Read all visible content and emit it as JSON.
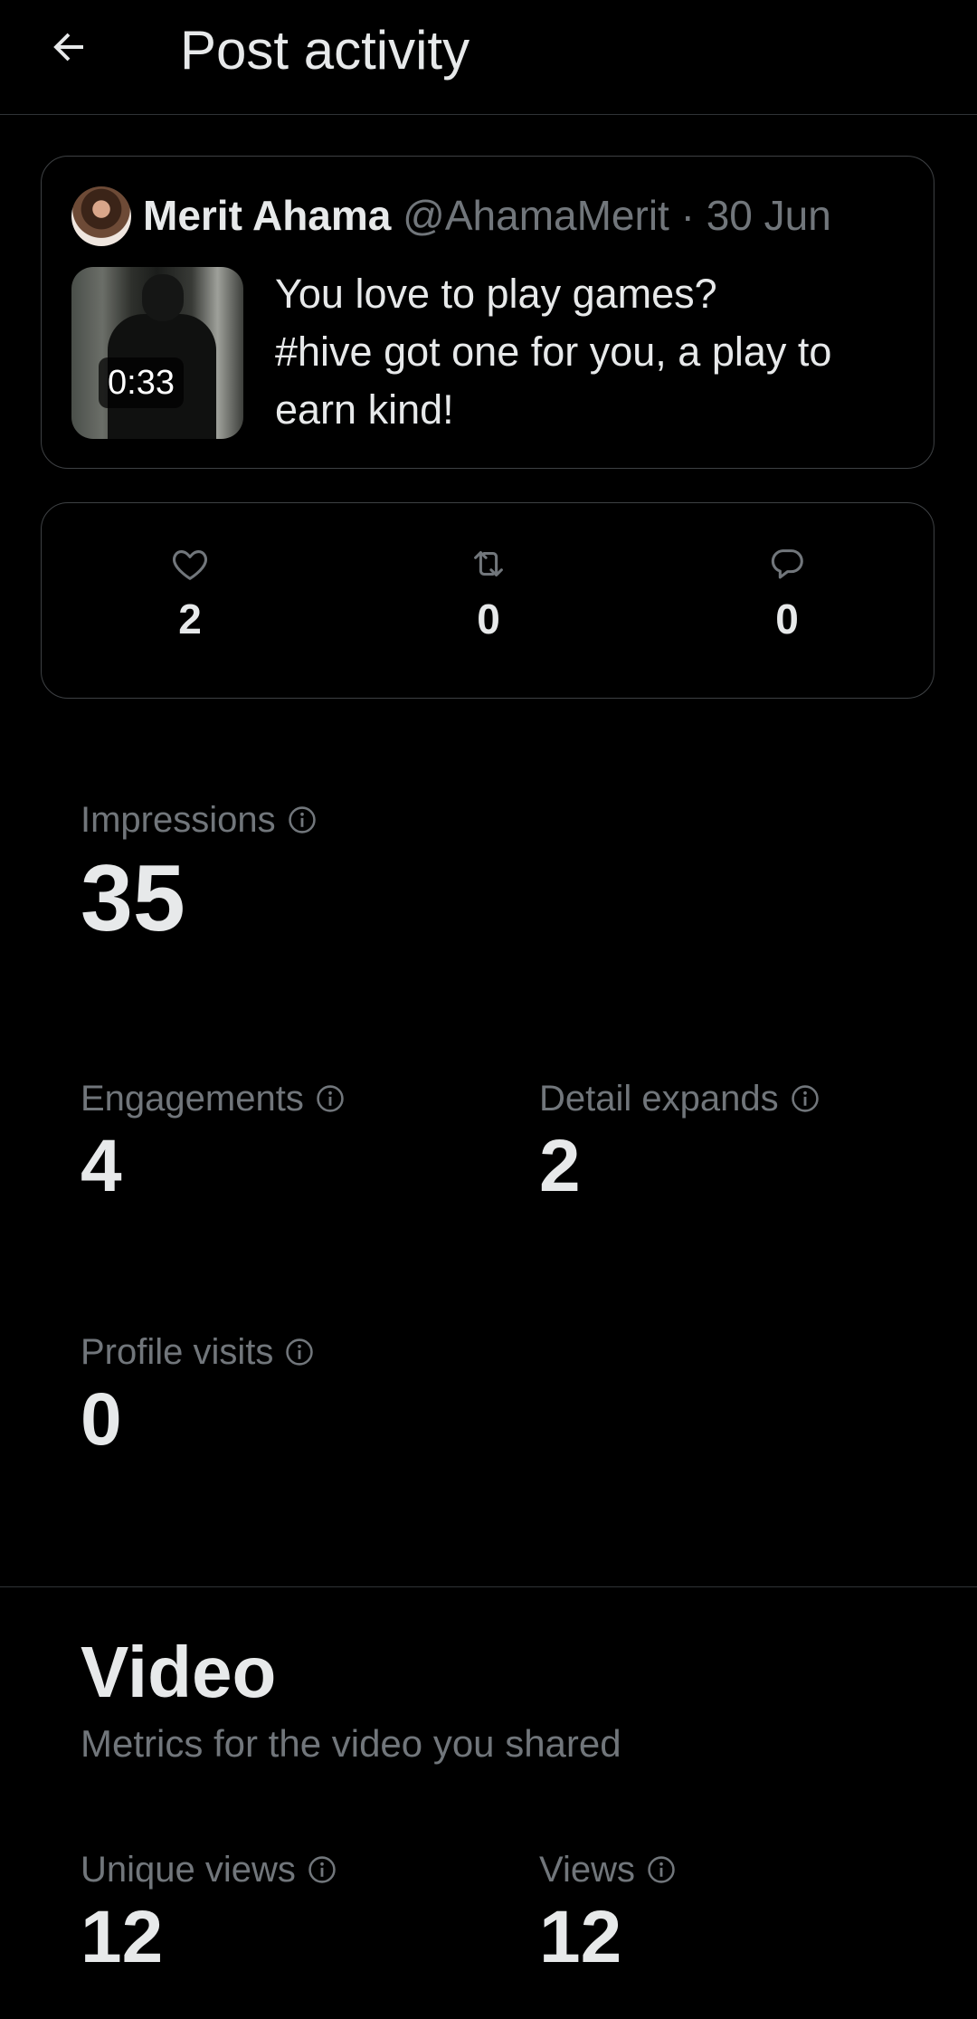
{
  "header": {
    "title": "Post activity"
  },
  "post": {
    "author_name": "Merit Ahama",
    "author_handle": "@AhamaMerit",
    "separator": "·",
    "date": "30 Jun",
    "video_duration": "0:33",
    "text_lines": [
      "You love to play games?",
      "#hive got one for you, a play to",
      "earn kind!"
    ]
  },
  "engagement_counts": {
    "likes": "2",
    "reposts": "0",
    "replies": "0"
  },
  "metrics": {
    "impressions": {
      "label": "Impressions",
      "value": "35"
    },
    "engagements": {
      "label": "Engagements",
      "value": "4"
    },
    "detail_expands": {
      "label": "Detail expands",
      "value": "2"
    },
    "profile_visits": {
      "label": "Profile visits",
      "value": "0"
    }
  },
  "video_section": {
    "title": "Video",
    "subtitle": "Metrics for the video you shared",
    "unique_views": {
      "label": "Unique views",
      "value": "12"
    },
    "views": {
      "label": "Views",
      "value": "12"
    }
  },
  "icons": {
    "back": "arrow-left-icon",
    "like": "heart-icon",
    "repost": "repost-icon",
    "reply": "speech-bubble-icon",
    "info": "info-circle-icon"
  },
  "colors": {
    "background": "#000000",
    "primary_text": "#e7e9ea",
    "secondary_text": "#71767b",
    "border": "#3e4144"
  }
}
